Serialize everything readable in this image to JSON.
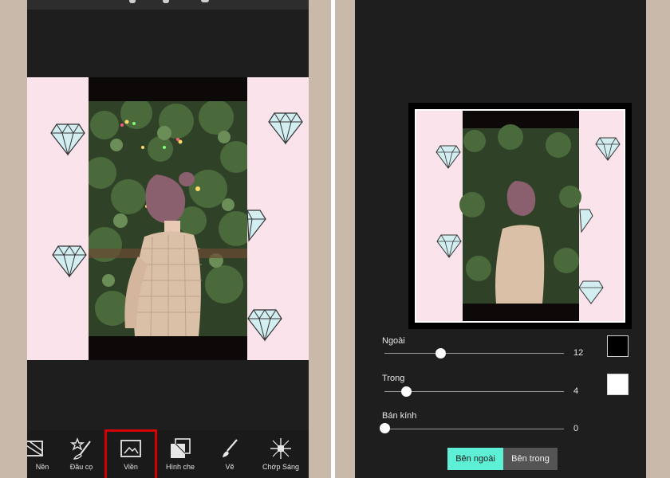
{
  "colors": {
    "screen_bg": "#1e1e1e",
    "frame_bg": "#c8b9ab",
    "pink_canvas": "#fae3ea",
    "highlight_red": "#d40000",
    "tab_active": "#5ef0d6",
    "tab_inactive": "#545454",
    "swatch_outer": "#000000",
    "swatch_inner": "#ffffff"
  },
  "toolbar": {
    "items": [
      {
        "label": "Nền",
        "icon": "background-icon"
      },
      {
        "label": "Đầu cọ",
        "icon": "brush-tip-icon"
      },
      {
        "label": "Viền",
        "icon": "border-frame-icon",
        "selected": true
      },
      {
        "label": "Hình che",
        "icon": "mask-icon"
      },
      {
        "label": "Vẽ",
        "icon": "draw-brush-icon"
      },
      {
        "label": "Chớp Sáng",
        "icon": "flash-sparkle-icon"
      }
    ]
  },
  "border_settings": {
    "outer": {
      "label": "Ngoài",
      "value": "12",
      "fraction": 0.31,
      "swatch": "#000000"
    },
    "inner": {
      "label": "Trong",
      "value": "4",
      "fraction": 0.12,
      "swatch": "#ffffff"
    },
    "radius": {
      "label": "Bán kính",
      "value": "0",
      "fraction": 0.0
    }
  },
  "tabs": {
    "outside_label": "Bên ngoài",
    "inside_label": "Bên trong",
    "active": "outside"
  }
}
